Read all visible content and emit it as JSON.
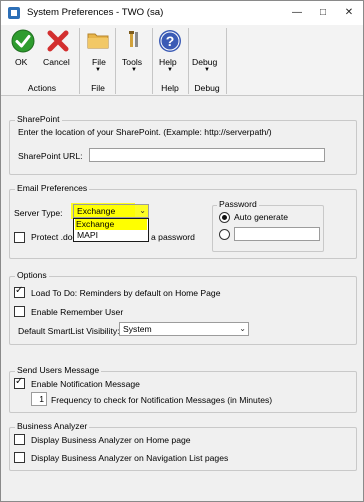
{
  "window": {
    "title": "System Preferences - TWO (sa)",
    "controls": {
      "minimize": "—",
      "maximize": "□",
      "close": "✕"
    }
  },
  "ribbon": {
    "buttons": [
      {
        "label": "OK",
        "icon": "ok-check-icon",
        "color": "#2e9c2e"
      },
      {
        "label": "Cancel",
        "icon": "cancel-x-icon",
        "color": "#d32f2f"
      },
      {
        "label": "File",
        "icon": "folder-icon",
        "has_menu": true
      },
      {
        "label": "Tools",
        "icon": "tools-icon",
        "has_menu": true
      },
      {
        "label": "Help",
        "icon": "help-icon",
        "has_menu": true,
        "color": "#3b5bb5"
      },
      {
        "label": "Debug",
        "icon": "debug-icon",
        "has_menu": true
      }
    ],
    "groups": [
      "Actions",
      "File",
      "Help",
      "Debug"
    ]
  },
  "sharepoint": {
    "legend": "SharePoint",
    "instruction": "Enter the location of your SharePoint. (Example: http://serverpath/)",
    "url_label": "SharePoint URL:",
    "url_value": ""
  },
  "email": {
    "legend": "Email Preferences",
    "server_type_label": "Server Type:",
    "server_type_value": "Exchange",
    "server_type_options": [
      "Exchange",
      "MAPI"
    ],
    "protect_label_left": "Protect .doc",
    "protect_label_right": "a password",
    "password_legend": "Password",
    "auto_generate_label": "Auto generate",
    "password_value": "",
    "highlight_color": "#ffff00"
  },
  "options": {
    "legend": "Options",
    "load_todo_label": "Load To Do: Reminders by default on Home Page",
    "load_todo_checked": true,
    "remember_user_label": "Enable Remember User",
    "remember_user_checked": false,
    "smartlist_label": "Default SmartList Visibility:",
    "smartlist_value": "System"
  },
  "send_users": {
    "legend": "Send Users Message",
    "enable_notification_label": "Enable Notification Message",
    "enable_notification_checked": true,
    "frequency_value": "1",
    "frequency_label": "Frequency to check for Notification Messages (in Minutes)"
  },
  "business_analyzer": {
    "legend": "Business Analyzer",
    "home_label": "Display Business Analyzer on Home page",
    "nav_label": "Display Business Analyzer on Navigation List pages"
  }
}
